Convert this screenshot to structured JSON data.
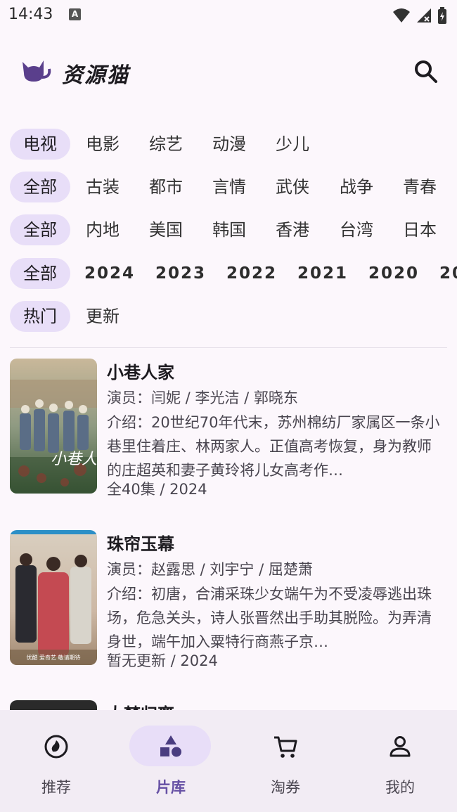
{
  "status_bar": {
    "time": "14:43",
    "notif_icon_letter": "A"
  },
  "header": {
    "app_name": "资源猫",
    "logo_icon": "cat-icon",
    "search_icon": "search-icon"
  },
  "filters": {
    "category": [
      "电视",
      "电影",
      "综艺",
      "动漫",
      "少儿"
    ],
    "genre": [
      "全部",
      "古装",
      "都市",
      "言情",
      "武侠",
      "战争",
      "青春"
    ],
    "region": [
      "全部",
      "内地",
      "美国",
      "韩国",
      "香港",
      "台湾",
      "日本"
    ],
    "year": [
      "全部",
      "2024",
      "2023",
      "2022",
      "2021",
      "2020",
      "20"
    ],
    "sort": [
      "热门",
      "更新"
    ]
  },
  "items": [
    {
      "title": "小巷人家",
      "actors": "演员：闫妮 / 李光洁 / 郭晓东",
      "desc": "介绍：20世纪70年代末，苏州棉纺厂家属区一条小巷里住着庄、林两家人。正值高考恢复，身为教师的庄超英和妻子黄玲将儿女高考作…",
      "meta": "全40集 / 2024",
      "poster_text": "小巷人家"
    },
    {
      "title": "珠帘玉幕",
      "actors": "演员：赵露思 / 刘宇宁 / 屈楚萧",
      "desc": "介绍：初唐，合浦采珠少女端午为不受凌辱逃出珠场，危急关头，诗人张晋然出手助其脱险。为弄清身世，端午加入粟特行商燕子京…",
      "meta": "暂无更新 / 2024",
      "poster_text": "优酷 爱奇艺 敬请期待"
    },
    {
      "title": "大梦归离",
      "actors": "",
      "desc": "",
      "meta": ""
    }
  ],
  "nav": [
    {
      "label": "推荐",
      "icon": "recommend-icon",
      "active": false
    },
    {
      "label": "片库",
      "icon": "library-icon",
      "active": true
    },
    {
      "label": "淘券",
      "icon": "cart-icon",
      "active": false
    },
    {
      "label": "我的",
      "icon": "profile-icon",
      "active": false
    }
  ],
  "colors": {
    "accent": "#6650a4",
    "chip_selected": "#e8def8",
    "background": "#fcf7fc",
    "nav_bg": "#f2ecf4"
  }
}
